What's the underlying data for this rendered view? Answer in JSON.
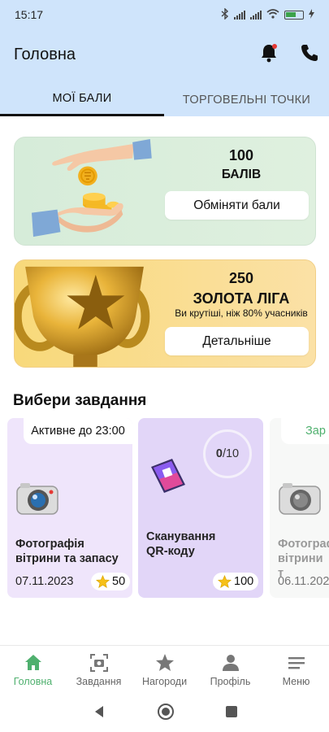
{
  "status_bar": {
    "time": "15:17",
    "battery": "28",
    "icons": [
      "bluetooth-icon",
      "signal-icon",
      "signal-icon",
      "wifi-icon",
      "battery-icon"
    ]
  },
  "header": {
    "title": "Головна",
    "tabs": [
      {
        "label": "МОЇ БАЛИ",
        "active": true
      },
      {
        "label": "ТОРГОВЕЛЬНІ ТОЧКИ",
        "active": false
      }
    ],
    "icons": [
      "bell-icon",
      "phone-icon"
    ],
    "accent": "#cfe4fb"
  },
  "points_card": {
    "value": "100",
    "unit": "БАЛІВ",
    "button_label": "Обміняти бали",
    "color": "#d6ecd9"
  },
  "league_card": {
    "value": "250",
    "league": "ЗОЛОТА ЛІГА",
    "subtitle": "Ви крутіші, ніж 80% учасників",
    "button_label": "Детальніше",
    "color": "#f8d97a"
  },
  "tasks_section": {
    "title": "Вибери завдання",
    "tasks": [
      {
        "badge": "Активне до  23:00",
        "icon": "camera-icon",
        "title_line1": "Фотографія",
        "title_line2": "вітрини та запасу",
        "date": "07.11.2023",
        "reward": "50"
      },
      {
        "progress_done": "0",
        "progress_total": "/10",
        "icon": "smartphone-icon",
        "title_line1": "Сканування",
        "title_line2": "QR-коду",
        "reward": "100"
      },
      {
        "badge": "Зар",
        "icon": "camera-icon",
        "title_line1": "Фотограф",
        "title_line2": "вітрини т",
        "date": "06.11.202"
      }
    ]
  },
  "bottom_nav": {
    "items": [
      {
        "label": "Головна",
        "icon": "home-icon",
        "active": true
      },
      {
        "label": "Завдання",
        "icon": "task-camera-icon",
        "active": false
      },
      {
        "label": "Нагороди",
        "icon": "star-icon",
        "active": false
      },
      {
        "label": "Профіль",
        "icon": "person-icon",
        "active": false
      },
      {
        "label": "Меню",
        "icon": "menu-icon",
        "active": false
      }
    ],
    "active_color": "#4fb06e"
  }
}
